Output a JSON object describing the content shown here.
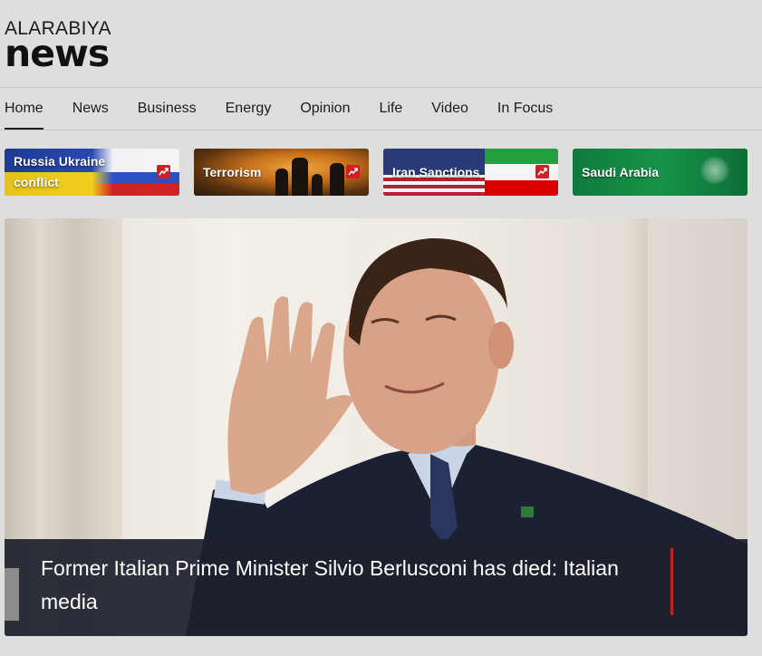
{
  "brand": {
    "logo_top": "ALARABIYA",
    "logo_bottom": "news"
  },
  "nav": {
    "items": [
      {
        "label": "Home",
        "active": true
      },
      {
        "label": "News"
      },
      {
        "label": "Business"
      },
      {
        "label": "Energy"
      },
      {
        "label": "Opinion"
      },
      {
        "label": "Life"
      },
      {
        "label": "Video"
      },
      {
        "label": "In Focus"
      }
    ]
  },
  "topics": [
    {
      "label": "Russia Ukraine conflict",
      "trending": true,
      "icon": "trending-icon"
    },
    {
      "label": "Terrorism",
      "trending": true,
      "icon": "trending-icon"
    },
    {
      "label": "Iran Sanctions",
      "trending": true,
      "icon": "trending-icon"
    },
    {
      "label": "Saudi Arabia",
      "trending": false
    }
  ],
  "hero": {
    "title": "Former Italian Prime Minister Silvio Berlusconi has died: Italian media"
  },
  "colors": {
    "background": "#dedede",
    "accent_red": "#c81e25",
    "caption_bg": "#1e212d",
    "text": "#1c1c1c"
  }
}
